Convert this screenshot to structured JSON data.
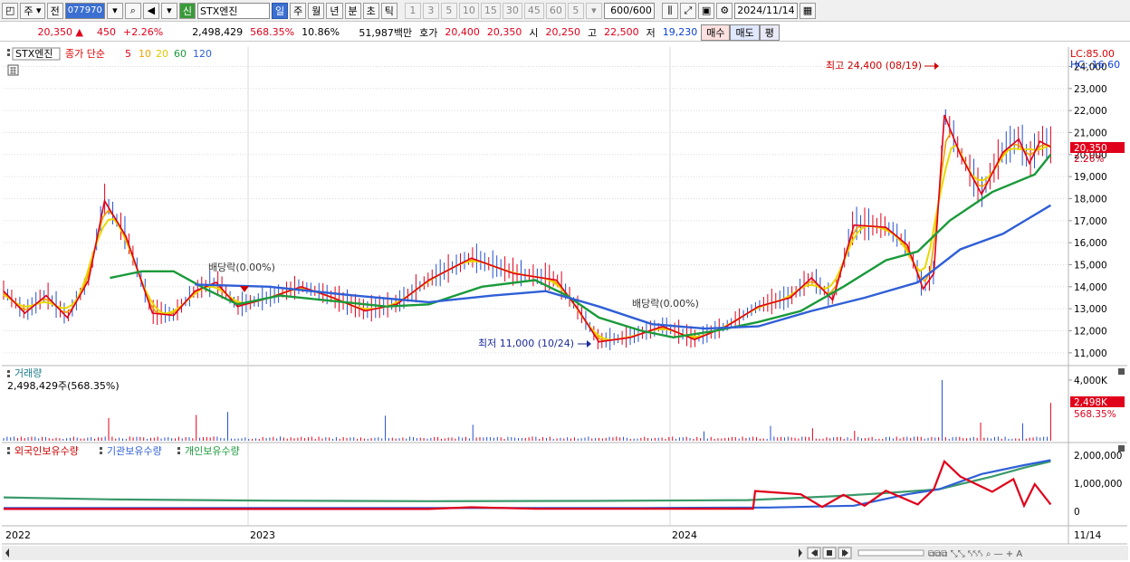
{
  "toolbar": {
    "period": "주",
    "period_all": "전",
    "code": "077970",
    "stock_badge": "신",
    "stock_name": "STX엔진",
    "tabs": [
      "일",
      "주",
      "월",
      "년",
      "분",
      "초",
      "틱"
    ],
    "nums": [
      "1",
      "3",
      "5",
      "10",
      "15",
      "30",
      "45",
      "60"
    ],
    "unit": "5",
    "count": "600",
    "total": "/600",
    "date": "2024/11/14"
  },
  "info": {
    "price": "20,350",
    "change": "450",
    "change_pct": "+2.26%",
    "volume": "2,498,429",
    "vol_ratio": "568.35%",
    "turnover": "10.86%",
    "amount": "51,987백만",
    "bid_label": "호가",
    "bid": "20,400",
    "ask": "20,350",
    "open_label": "시",
    "open": "20,250",
    "high_label": "고",
    "high": "22,500",
    "low_label": "저",
    "low": "19,230",
    "buy": "매수",
    "sell": "매도",
    "eval": "평"
  },
  "legend": {
    "name": "STX엔진",
    "title": "종가 단순",
    "ma": [
      {
        "label": "5",
        "color": "#e0001b"
      },
      {
        "label": "10",
        "color": "#f0a000"
      },
      {
        "label": "20",
        "color": "#e8d800"
      },
      {
        "label": "60",
        "color": "#1a9a3a"
      },
      {
        "label": "120",
        "color": "#2f5fd6"
      }
    ]
  },
  "price_panel": {
    "lc": "LC:85.00",
    "hc": "HC:-16.60",
    "last": "20,350",
    "last_pct": "2.26%",
    "high_ann": "최고 24,400 (08/19)",
    "low_ann": "최저 11,000 (10/24)",
    "div1": "배당락(0.00%)",
    "div2": "배당락(0.00%)"
  },
  "volume_panel": {
    "title": "거래량",
    "value": "2,498,429주(568.35%)",
    "tick_top": "4,000K",
    "last": "2,498K",
    "last_pct": "568.35%"
  },
  "holdings_panel": {
    "foreign": "외국인보유수량",
    "inst": "기관보유수량",
    "indiv": "개인보유수량",
    "ticks": [
      "2,000,000",
      "1,000,000",
      "0"
    ],
    "end_date": "11/14"
  },
  "xaxis": [
    "2022",
    "2023",
    "2024"
  ],
  "chart_data": {
    "type": "line",
    "title": "STX엔진 종가 단순",
    "ylim": [
      10500,
      24800
    ],
    "yticks": [
      11000,
      12000,
      13000,
      14000,
      15000,
      16000,
      17000,
      18000,
      19000,
      20000,
      21000,
      22000,
      23000,
      24000
    ],
    "close": [
      {
        "t": 0.0,
        "v": 13800
      },
      {
        "t": 0.02,
        "v": 12800
      },
      {
        "t": 0.04,
        "v": 13600
      },
      {
        "t": 0.06,
        "v": 12600
      },
      {
        "t": 0.08,
        "v": 14300
      },
      {
        "t": 0.095,
        "v": 17900
      },
      {
        "t": 0.115,
        "v": 16300
      },
      {
        "t": 0.14,
        "v": 12800
      },
      {
        "t": 0.16,
        "v": 12700
      },
      {
        "t": 0.18,
        "v": 13800
      },
      {
        "t": 0.2,
        "v": 14200
      },
      {
        "t": 0.22,
        "v": 13100
      },
      {
        "t": 0.25,
        "v": 13500
      },
      {
        "t": 0.28,
        "v": 14000
      },
      {
        "t": 0.31,
        "v": 13500
      },
      {
        "t": 0.34,
        "v": 12900
      },
      {
        "t": 0.37,
        "v": 13200
      },
      {
        "t": 0.4,
        "v": 14300
      },
      {
        "t": 0.44,
        "v": 15300
      },
      {
        "t": 0.48,
        "v": 14600
      },
      {
        "t": 0.52,
        "v": 14300
      },
      {
        "t": 0.54,
        "v": 13000
      },
      {
        "t": 0.56,
        "v": 11500
      },
      {
        "t": 0.59,
        "v": 11700
      },
      {
        "t": 0.62,
        "v": 12200
      },
      {
        "t": 0.65,
        "v": 11600
      },
      {
        "t": 0.68,
        "v": 12200
      },
      {
        "t": 0.71,
        "v": 13100
      },
      {
        "t": 0.74,
        "v": 13500
      },
      {
        "t": 0.76,
        "v": 14400
      },
      {
        "t": 0.78,
        "v": 13400
      },
      {
        "t": 0.8,
        "v": 16800
      },
      {
        "t": 0.83,
        "v": 16700
      },
      {
        "t": 0.85,
        "v": 15900
      },
      {
        "t": 0.865,
        "v": 13900
      },
      {
        "t": 0.875,
        "v": 14600
      },
      {
        "t": 0.885,
        "v": 21800
      },
      {
        "t": 0.9,
        "v": 20000
      },
      {
        "t": 0.92,
        "v": 18200
      },
      {
        "t": 0.94,
        "v": 20100
      },
      {
        "t": 0.955,
        "v": 20700
      },
      {
        "t": 0.965,
        "v": 19600
      },
      {
        "t": 0.975,
        "v": 20600
      },
      {
        "t": 0.985,
        "v": 20350
      }
    ],
    "ma60": [
      {
        "t": 0.1,
        "v": 14400
      },
      {
        "t": 0.13,
        "v": 14700
      },
      {
        "t": 0.16,
        "v": 14700
      },
      {
        "t": 0.19,
        "v": 13900
      },
      {
        "t": 0.22,
        "v": 13200
      },
      {
        "t": 0.26,
        "v": 13600
      },
      {
        "t": 0.3,
        "v": 13400
      },
      {
        "t": 0.36,
        "v": 13100
      },
      {
        "t": 0.4,
        "v": 13200
      },
      {
        "t": 0.45,
        "v": 14000
      },
      {
        "t": 0.5,
        "v": 14300
      },
      {
        "t": 0.53,
        "v": 13600
      },
      {
        "t": 0.56,
        "v": 12600
      },
      {
        "t": 0.6,
        "v": 12000
      },
      {
        "t": 0.63,
        "v": 11700
      },
      {
        "t": 0.67,
        "v": 12000
      },
      {
        "t": 0.71,
        "v": 12400
      },
      {
        "t": 0.75,
        "v": 12900
      },
      {
        "t": 0.79,
        "v": 14000
      },
      {
        "t": 0.83,
        "v": 15200
      },
      {
        "t": 0.86,
        "v": 15600
      },
      {
        "t": 0.89,
        "v": 17000
      },
      {
        "t": 0.93,
        "v": 18300
      },
      {
        "t": 0.97,
        "v": 19100
      },
      {
        "t": 0.985,
        "v": 20000
      }
    ],
    "ma120": [
      {
        "t": 0.18,
        "v": 14100
      },
      {
        "t": 0.25,
        "v": 14000
      },
      {
        "t": 0.33,
        "v": 13600
      },
      {
        "t": 0.4,
        "v": 13300
      },
      {
        "t": 0.46,
        "v": 13600
      },
      {
        "t": 0.51,
        "v": 13800
      },
      {
        "t": 0.56,
        "v": 13100
      },
      {
        "t": 0.61,
        "v": 12300
      },
      {
        "t": 0.66,
        "v": 12100
      },
      {
        "t": 0.71,
        "v": 12200
      },
      {
        "t": 0.76,
        "v": 12900
      },
      {
        "t": 0.81,
        "v": 13500
      },
      {
        "t": 0.86,
        "v": 14200
      },
      {
        "t": 0.9,
        "v": 15700
      },
      {
        "t": 0.94,
        "v": 16400
      },
      {
        "t": 0.985,
        "v": 17700
      }
    ],
    "volume_k": [
      {
        "t": 0.1,
        "v": 1500
      },
      {
        "t": 0.18,
        "v": 1700
      },
      {
        "t": 0.21,
        "v": 1900
      },
      {
        "t": 0.36,
        "v": 1650
      },
      {
        "t": 0.44,
        "v": 1050
      },
      {
        "t": 0.66,
        "v": 620
      },
      {
        "t": 0.72,
        "v": 980
      },
      {
        "t": 0.76,
        "v": 820
      },
      {
        "t": 0.8,
        "v": 650
      },
      {
        "t": 0.882,
        "v": 4000
      },
      {
        "t": 0.92,
        "v": 1200
      },
      {
        "t": 0.96,
        "v": 1150
      },
      {
        "t": 0.985,
        "v": 2498
      }
    ],
    "holdings": {
      "foreign": [
        {
          "t": 0.0,
          "v": 20000
        },
        {
          "t": 0.4,
          "v": 20000
        },
        {
          "t": 0.44,
          "v": 90000
        },
        {
          "t": 0.5,
          "v": 30000
        },
        {
          "t": 0.705,
          "v": 30000
        },
        {
          "t": 0.707,
          "v": 730000
        },
        {
          "t": 0.75,
          "v": 600000
        },
        {
          "t": 0.77,
          "v": 100000
        },
        {
          "t": 0.79,
          "v": 580000
        },
        {
          "t": 0.81,
          "v": 150000
        },
        {
          "t": 0.83,
          "v": 740000
        },
        {
          "t": 0.86,
          "v": 200000
        },
        {
          "t": 0.875,
          "v": 800000
        },
        {
          "t": 0.885,
          "v": 1900000
        },
        {
          "t": 0.9,
          "v": 1300000
        },
        {
          "t": 0.93,
          "v": 700000
        },
        {
          "t": 0.95,
          "v": 1200000
        },
        {
          "t": 0.96,
          "v": 150000
        },
        {
          "t": 0.97,
          "v": 1000000
        },
        {
          "t": 0.985,
          "v": 200000
        }
      ],
      "institution": [
        {
          "t": 0.0,
          "v": 60000
        },
        {
          "t": 0.6,
          "v": 60000
        },
        {
          "t": 0.72,
          "v": 80000
        },
        {
          "t": 0.8,
          "v": 150000
        },
        {
          "t": 0.85,
          "v": 600000
        },
        {
          "t": 0.88,
          "v": 800000
        },
        {
          "t": 0.92,
          "v": 1400000
        },
        {
          "t": 0.96,
          "v": 1750000
        },
        {
          "t": 0.985,
          "v": 1950000
        }
      ],
      "individual": [
        {
          "t": 0.0,
          "v": 480000
        },
        {
          "t": 0.1,
          "v": 400000
        },
        {
          "t": 0.25,
          "v": 350000
        },
        {
          "t": 0.4,
          "v": 330000
        },
        {
          "t": 0.55,
          "v": 340000
        },
        {
          "t": 0.7,
          "v": 370000
        },
        {
          "t": 0.78,
          "v": 520000
        },
        {
          "t": 0.83,
          "v": 650000
        },
        {
          "t": 0.88,
          "v": 800000
        },
        {
          "t": 0.93,
          "v": 1300000
        },
        {
          "t": 0.96,
          "v": 1650000
        },
        {
          "t": 0.985,
          "v": 1900000
        }
      ]
    }
  }
}
